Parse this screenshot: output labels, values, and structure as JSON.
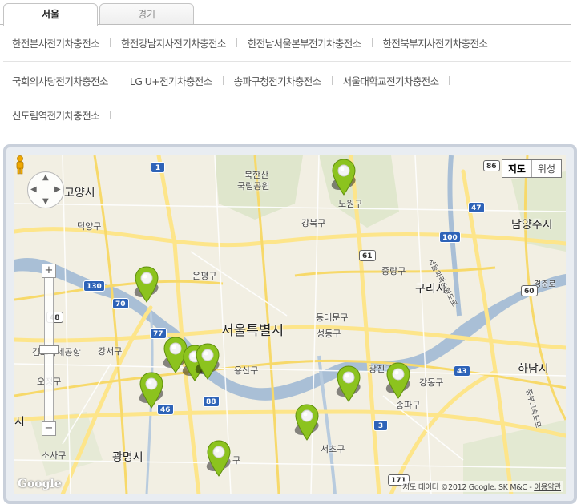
{
  "tabs": [
    {
      "label": "서울",
      "active": true
    },
    {
      "label": "경기",
      "active": false
    }
  ],
  "stations": {
    "row1": [
      "한전본사전기차충전소",
      "한전강남지사전기차충전소",
      "한전남서울본부전기차충전소",
      "한전북부지사전기차충전소"
    ],
    "row2": [
      "국회의사당전기차충전소",
      "LG U+전기차충전소",
      "송파구청전기차충전소",
      "서울대학교전기차충전소"
    ],
    "row3": [
      "신도림역전기차충전소"
    ]
  },
  "map": {
    "type_buttons": {
      "map": "지도",
      "satellite": "위성"
    },
    "labels": {
      "seoul": "서울특별시",
      "goyang": "고양시",
      "namyangju": "남양주시",
      "guri": "구리시",
      "hanam": "하남시",
      "gwangmyeong": "광명시",
      "bukhansan1": "북한산",
      "bukhansan2": "국립공원",
      "nowon": "노원구",
      "gangbuk": "강북구",
      "deogyang": "덕양구",
      "eunpyeong": "은평구",
      "jungnang": "중랑구",
      "dongdaemun": "동대문구",
      "seongdong": "성동구",
      "gangseo": "강서구",
      "gimpo": "김포국제공항",
      "ojeong": "오정구",
      "yongsan": "용산구",
      "gwangjin": "광진구",
      "gangdong": "강동구",
      "songpa": "송파구",
      "seocho": "서초구",
      "sosa": "소사구",
      "si_left": "시",
      "gu_bottom": "구",
      "gyeongchun": "경춘로",
      "seoul_ring": "서울외곽순환도로",
      "hana": "중부고속도로"
    },
    "route_numbers": [
      "1",
      "86",
      "47",
      "100",
      "61",
      "130",
      "70",
      "48",
      "77",
      "88",
      "60",
      "43",
      "3",
      "171",
      "46"
    ],
    "google": "Google",
    "copyright_text": "지도 데이터 ©2012 Google, SK M&C - ",
    "copyright_link": "이용약관",
    "pin_count": 10,
    "pin_color": "#8cc31e",
    "water_color": "#a9bfd6",
    "road_color": "#fde58a"
  }
}
